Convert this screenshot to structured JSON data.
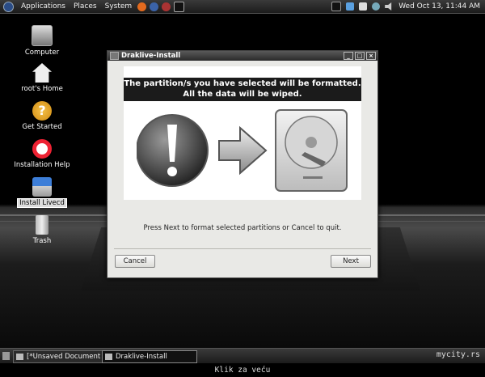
{
  "top_panel": {
    "menu": [
      "Applications",
      "Places",
      "System"
    ],
    "clock": "Wed Oct 13, 11:44 AM"
  },
  "desktop_icons": [
    {
      "label": "Computer",
      "icon": "computer-icon"
    },
    {
      "label": "root's Home",
      "icon": "home-icon"
    },
    {
      "label": "Get Started",
      "icon": "help-icon"
    },
    {
      "label": "Installation Help",
      "icon": "lifebuoy-icon"
    },
    {
      "label": "Install Livecd",
      "icon": "install-icon"
    },
    {
      "label": "Trash",
      "icon": "trash-icon"
    }
  ],
  "dialog": {
    "title": "Draklive-Install",
    "banner_line1": "The partition/s you have selected will be formatted.",
    "banner_line2": "All the data will be wiped.",
    "instruction": "Press Next to format selected partitions or Cancel to quit.",
    "cancel_label": "Cancel",
    "next_label": "Next"
  },
  "taskbar": {
    "tasks": [
      "[*Unsaved Document ...",
      "Draklive-Install"
    ]
  },
  "watermark": "mycity.rs",
  "caption": "Klik za veću",
  "colors": {
    "panel": "#2a2a2a",
    "banner": "#1b1b1b",
    "dialog_bg": "#e9e9e6"
  }
}
